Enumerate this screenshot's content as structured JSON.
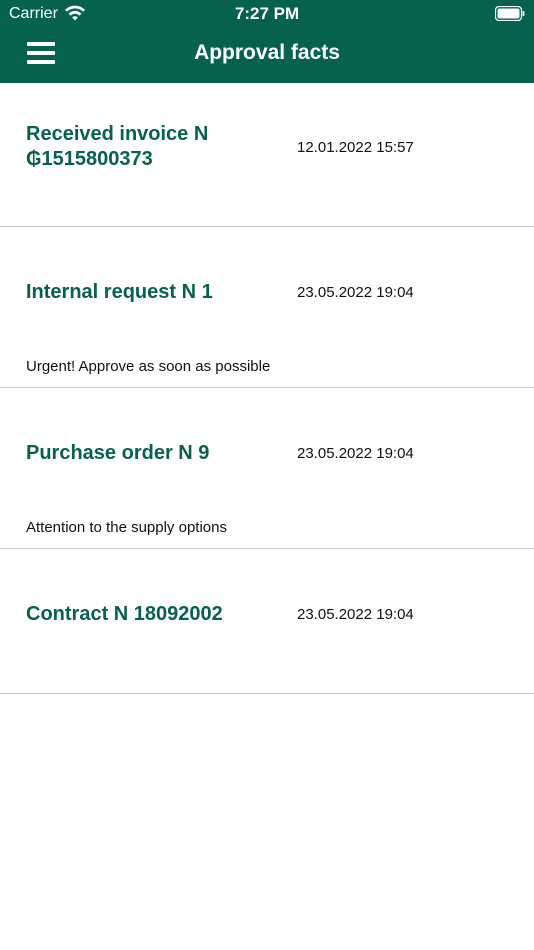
{
  "status_bar": {
    "carrier": "Carrier",
    "time": "7:27 PM"
  },
  "header": {
    "title": "Approval facts",
    "menu_icon": "hamburger-menu-icon"
  },
  "colors": {
    "header_bg": "#06614f",
    "title_accent": "#06614f",
    "divider": "#c8c8c8"
  },
  "items": [
    {
      "title": "Received invoice N ₲1515800373",
      "date": "12.01.2022 15:57",
      "comment": ""
    },
    {
      "title": "Internal request N 1",
      "date": "23.05.2022 19:04",
      "comment": "Urgent! Approve as soon as possible"
    },
    {
      "title": "Purchase order N 9",
      "date": "23.05.2022 19:04",
      "comment": "Attention to the supply options"
    },
    {
      "title": "Contract N 18092002",
      "date": "23.05.2022 19:04",
      "comment": ""
    }
  ]
}
